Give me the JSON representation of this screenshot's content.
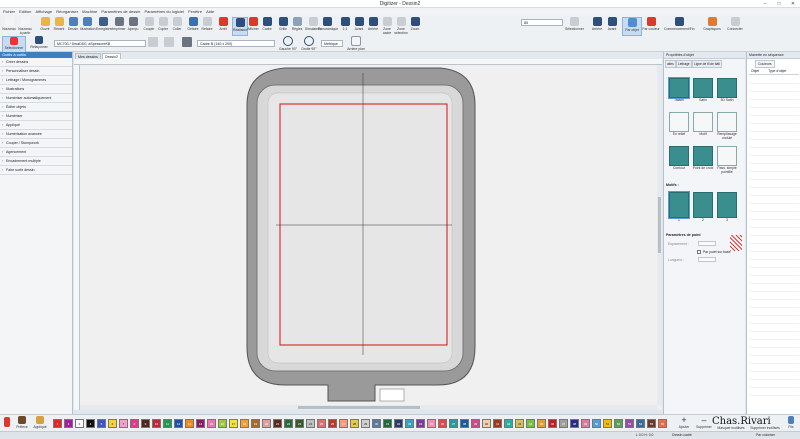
{
  "window": {
    "title": "Digitizer - Dessin2",
    "min": "–",
    "max": "□",
    "close": "✕"
  },
  "menu": [
    "Fichier",
    "Edition",
    "Affichage",
    "Réorganiser",
    "Machine",
    "Paramètres de dessin",
    "Paramètres du logiciel",
    "Fenêtre",
    "Aide"
  ],
  "ribbon": {
    "buttons": [
      {
        "label": "Nouveau",
        "icon": "new-file-icon",
        "color": "#f4f4f4"
      },
      {
        "label": "Nouveau à partir",
        "icon": "new-from-icon",
        "color": "#f4f4f4"
      },
      {
        "label": "Ouvrir",
        "icon": "open-folder-icon",
        "color": "#e9b54a"
      },
      {
        "label": "Récent",
        "icon": "recent-icon",
        "color": "#e9b54a"
      },
      {
        "label": "Dessin",
        "icon": "design-icon",
        "color": "#4f7fb8"
      },
      {
        "label": "Illustration",
        "icon": "illustration-icon",
        "color": "#4f7fb8"
      },
      {
        "label": "Enregistrer",
        "icon": "save-icon",
        "color": "#3e5f8a"
      },
      {
        "label": "Imprimer",
        "icon": "print-icon",
        "color": "#6b7480"
      },
      {
        "label": "Aperçu",
        "icon": "preview-icon",
        "color": "#6b7480"
      },
      {
        "label": "Couper",
        "icon": "cut-icon",
        "color": "#c9cdd2"
      },
      {
        "label": "Copier",
        "icon": "copy-icon",
        "color": "#c9cdd2"
      },
      {
        "label": "Coller",
        "icon": "paste-icon",
        "color": "#c9cdd2"
      },
      {
        "label": "Défaire",
        "icon": "undo-icon",
        "color": "#3a6fb0"
      },
      {
        "label": "Refaire",
        "icon": "redo-icon",
        "color": "#c9cdd2"
      },
      {
        "label": "Arrêt",
        "icon": "stop-icon",
        "color": "#d93a2b"
      },
      {
        "label": "Réalisme",
        "icon": "realism-icon",
        "color": "#2e4f7a"
      },
      {
        "label": "Afficher",
        "icon": "show-icon",
        "color": "#d93a2b"
      },
      {
        "label": "Cadre",
        "icon": "hoop-icon",
        "color": "#2e4f7a"
      },
      {
        "label": "Grille",
        "icon": "grid-icon",
        "color": "#2e4f7a"
      },
      {
        "label": "Règles",
        "icon": "rulers-icon",
        "color": "#8da2b8"
      },
      {
        "label": "Simulateur",
        "icon": "simulator-icon",
        "color": "#c9cdd2"
      },
      {
        "label": "Panoramique",
        "icon": "pan-icon",
        "color": "#2e4f7a"
      },
      {
        "label": "1:1",
        "icon": "zoom-11-icon",
        "color": "#2e4f7a"
      },
      {
        "label": "Avant",
        "icon": "zoom-in-icon",
        "color": "#2e4f7a"
      },
      {
        "label": "Arrière",
        "icon": "zoom-out-icon",
        "color": "#2e4f7a"
      },
      {
        "label": "Zone cadre",
        "icon": "zoom-hoop-icon",
        "color": "#c9cdd2"
      },
      {
        "label": "Zone sélection",
        "icon": "zoom-selection-icon",
        "color": "#c9cdd2"
      },
      {
        "label": "Zoom",
        "icon": "zoom-icon",
        "color": "#2e4f7a"
      }
    ],
    "zoom_value": "85",
    "right_buttons": [
      {
        "label": "Sélectionner",
        "icon": "select-all-icon",
        "color": "#c9cdd2"
      },
      {
        "label": "Arrière",
        "icon": "back-arrow-icon",
        "color": "#2e4f7a"
      },
      {
        "label": "Avant",
        "icon": "forward-arrow-icon",
        "color": "#2e4f7a"
      },
      {
        "label": "Par objet",
        "icon": "by-object-icon",
        "color": "#4f8fd0"
      },
      {
        "label": "Par couleur",
        "icon": "by-color-icon",
        "color": "#d93a2b"
      },
      {
        "label": "Commencement/Fin",
        "icon": "start-end-icon",
        "color": "#2e4f7a"
      },
      {
        "label": "Graphiques",
        "icon": "graphics-icon",
        "color": "#e07a2f"
      },
      {
        "label": "Connecter",
        "icon": "connect-icon",
        "color": "#c9cdd2"
      }
    ],
    "row2": {
      "select_label": "Sélectionner",
      "reshape_label": "Refaçonner",
      "machine": "MC700 / DmaDD0, aSpessoreKB",
      "hoop": "Cadre B (140 x 200)",
      "units": "Métrique",
      "rotate_left": "Gauche 90°",
      "rotate_right": "Droite 90°",
      "hoop_info": "Arrière plan"
    }
  },
  "left_panel": {
    "header": "Outils à outils",
    "items": [
      "Créer dessins",
      "Personnaliser dessin",
      "Lettrage / Monogrammes",
      "Illustrations",
      "Numériser automatiquement",
      "Éditer objets",
      "Numériser",
      "Appliqué",
      "Numérisation avancée",
      "Couper / Stumpwork",
      "Agencement",
      "Encadrement multiple",
      "Faire sortir dessin"
    ]
  },
  "tabs": [
    "Mes dessins",
    "Dessin2"
  ],
  "properties": {
    "header": "Propriétés d'objet",
    "tabs": [
      "aites",
      "Lettrage",
      "Ligne de fil de bâti"
    ],
    "stitch_types": [
      {
        "label": "Tatami",
        "style": "teal",
        "selected": true
      },
      {
        "label": "Satin",
        "style": "teal",
        "selected": false
      },
      {
        "label": "3D Satin",
        "style": "teal",
        "selected": false
      },
      {
        "label": "En relief",
        "style": "white",
        "selected": false
      },
      {
        "label": "Motif",
        "style": "white",
        "selected": false
      },
      {
        "label": "Remplissage ondulé",
        "style": "white",
        "selected": false
      },
      {
        "label": "Contour",
        "style": "teal",
        "selected": false
      },
      {
        "label": "Point de croix",
        "style": "teal",
        "selected": false
      },
      {
        "label": "Pass. simple pointillé",
        "style": "white",
        "selected": false
      }
    ],
    "pattern_header": "Motifs :",
    "patterns": [
      "1",
      "2",
      "3"
    ],
    "params_header": "Paramètres de point",
    "param_spacing": "Espacement :",
    "param_random": "Par jouet sur base",
    "param_length": "Longueur :"
  },
  "sequence": {
    "header": "Manette en séquence",
    "tabs": [
      "Couleurs"
    ],
    "columns": [
      "Objet",
      "Type d'objet"
    ]
  },
  "palette": {
    "tools": [
      {
        "label": "Préleve",
        "icon": "eyedropper-icon"
      },
      {
        "label": "Appliqué",
        "icon": "apply-color-icon"
      }
    ],
    "swatches": [
      {
        "n": "1",
        "c": "#e5261f"
      },
      {
        "n": "2",
        "c": "#a020a0"
      },
      {
        "n": "3",
        "c": "#ffffff"
      },
      {
        "n": "4",
        "c": "#101010"
      },
      {
        "n": "5",
        "c": "#3b56c4"
      },
      {
        "n": "6",
        "c": "#f7d23a"
      },
      {
        "n": "7",
        "c": "#f5a0c6"
      },
      {
        "n": "8",
        "c": "#e23a8a"
      },
      {
        "n": "9",
        "c": "#4b2a1a"
      },
      {
        "n": "10",
        "c": "#c0283a"
      },
      {
        "n": "11",
        "c": "#1f9a4a"
      },
      {
        "n": "12",
        "c": "#1f4fa8"
      },
      {
        "n": "13",
        "c": "#f08a1f"
      },
      {
        "n": "14",
        "c": "#8a1a6a"
      },
      {
        "n": "15",
        "c": "#e67ab0"
      },
      {
        "n": "16",
        "c": "#9fc93b"
      },
      {
        "n": "17",
        "c": "#f3e23a"
      },
      {
        "n": "18",
        "c": "#f2a02a"
      },
      {
        "n": "19",
        "c": "#a86a2a"
      },
      {
        "n": "20",
        "c": "#d9a0a0"
      },
      {
        "n": "21",
        "c": "#5e2a1e"
      },
      {
        "n": "22",
        "c": "#2a6a3a"
      },
      {
        "n": "23",
        "c": "#3a5a2a"
      },
      {
        "n": "24",
        "c": "#c0c0c0"
      },
      {
        "n": "25",
        "c": "#e07070"
      },
      {
        "n": "26",
        "c": "#b83a2a"
      },
      {
        "n": "27",
        "c": "#f59a7a"
      },
      {
        "n": "28",
        "c": "#e6c84a"
      },
      {
        "n": "29",
        "c": "#d0d0d0"
      },
      {
        "n": "30",
        "c": "#5a7aa0"
      },
      {
        "n": "31",
        "c": "#1e6a3a"
      },
      {
        "n": "32",
        "c": "#2a3a6a"
      },
      {
        "n": "33",
        "c": "#3aa0c0"
      },
      {
        "n": "34",
        "c": "#7a3a9a"
      },
      {
        "n": "35",
        "c": "#f090b0"
      },
      {
        "n": "36",
        "c": "#e04a4a"
      },
      {
        "n": "37",
        "c": "#2a9a9a"
      },
      {
        "n": "38",
        "c": "#1a5aa0"
      },
      {
        "n": "39",
        "c": "#d04a8a"
      },
      {
        "n": "40",
        "c": "#f0d0a0"
      },
      {
        "n": "41",
        "c": "#9a3a1a"
      },
      {
        "n": "42",
        "c": "#2ab0a0"
      },
      {
        "n": "43",
        "c": "#d8c060"
      },
      {
        "n": "44",
        "c": "#7ac040"
      },
      {
        "n": "45",
        "c": "#e0a030"
      },
      {
        "n": "46",
        "c": "#c02020"
      },
      {
        "n": "47",
        "c": "#a0a0a0"
      },
      {
        "n": "48",
        "c": "#2a2a8a"
      },
      {
        "n": "49",
        "c": "#e07aa0"
      },
      {
        "n": "50",
        "c": "#50a0d0"
      },
      {
        "n": "51",
        "c": "#f0c000"
      },
      {
        "n": "52",
        "c": "#5aa05a"
      },
      {
        "n": "53",
        "c": "#9a4aa0"
      },
      {
        "n": "54",
        "c": "#3a6a9a"
      },
      {
        "n": "55",
        "c": "#6a3a2a"
      },
      {
        "n": "56",
        "c": "#f06a4a"
      }
    ],
    "add_label": "Ajouter",
    "remove_label": "Supprimer",
    "mask_label": "Masquer inutilisés",
    "delete_unused_label": "Supprimer inutilisés",
    "file_label": "Fils",
    "thread_brand": "Chas.Rivari"
  },
  "status": {
    "coords": "L    0.0 H:   0.0",
    "mode": "Dessin cadré",
    "color_mode": "Par coloriser"
  }
}
